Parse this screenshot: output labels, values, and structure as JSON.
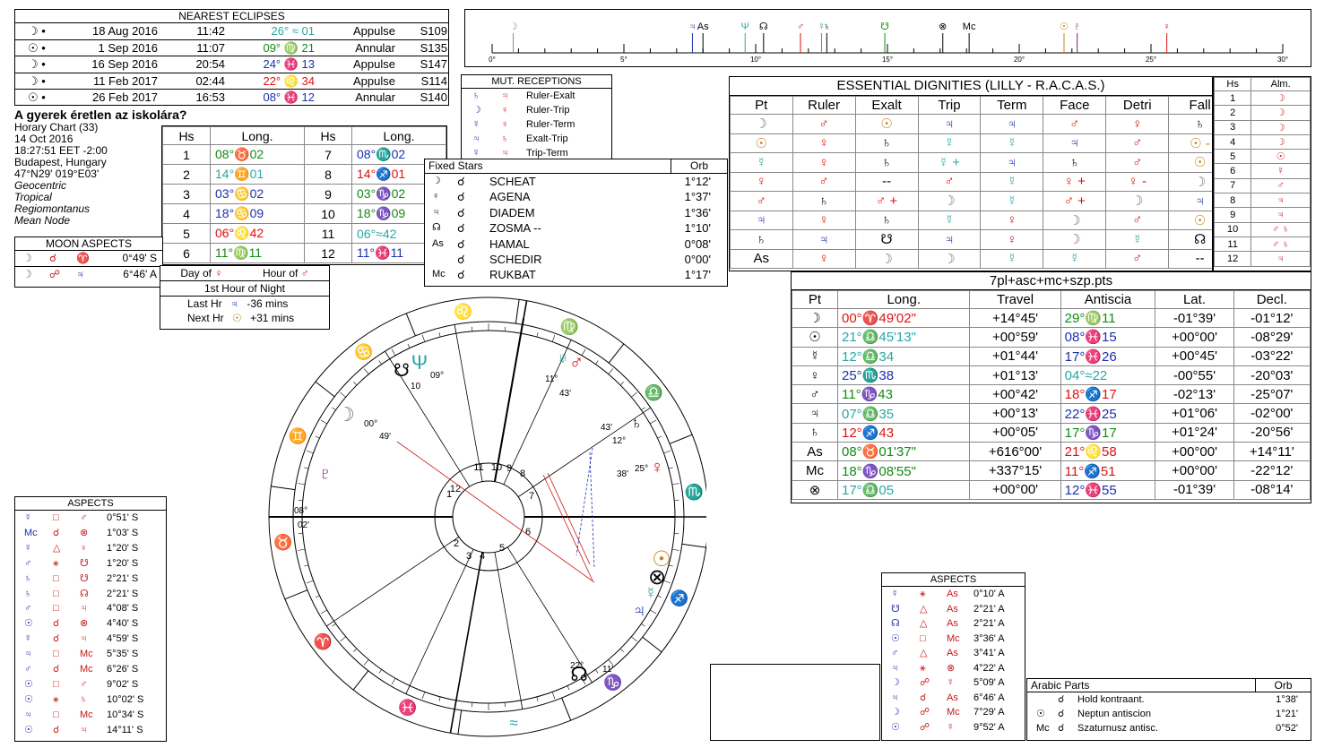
{
  "eclipses": {
    "title": "NEAREST ECLIPSES",
    "rows": [
      {
        "sym": "☽ •",
        "date": "18 Aug 2016",
        "time": "11:42",
        "pos": "26° ≈ 01",
        "pos_color": "#2aa6a6",
        "type": "Appulse",
        "saros": "S109"
      },
      {
        "sym": "☉ •",
        "date": "1 Sep 2016",
        "time": "11:07",
        "pos": "09° ♍ 21",
        "pos_color": "#138a13",
        "type": "Annular",
        "saros": "S135"
      },
      {
        "sym": "☽ •",
        "date": "16 Sep 2016",
        "time": "20:54",
        "pos": "24° ♓ 13",
        "pos_color": "#1c2fb0",
        "type": "Appulse",
        "saros": "S147"
      },
      {
        "sym": "☽ •",
        "date": "11 Feb 2017",
        "time": "02:44",
        "pos": "22° ♌ 34",
        "pos_color": "#e01010",
        "type": "Appulse",
        "saros": "S114"
      },
      {
        "sym": "☉ •",
        "date": "26 Feb 2017",
        "time": "16:53",
        "pos": "08° ♓ 12",
        "pos_color": "#1c2fb0",
        "type": "Annular",
        "saros": "S140"
      }
    ]
  },
  "chart_info": {
    "title": "A gyerek éretlen az iskolára?",
    "lines": [
      "Horary Chart (33)",
      "14 Oct 2016",
      "18:27:51  EET -2:00",
      "Budapest, Hungary",
      "47°N29' 019°E03'"
    ],
    "italic_lines": [
      "Geocentric",
      "Tropical",
      "Regiomontanus",
      "Mean Node"
    ]
  },
  "houses": {
    "headers": [
      "Hs",
      "Long.",
      "Hs",
      "Long."
    ],
    "rows": [
      {
        "h1": "1",
        "l1": "08°♉02",
        "c1": "#138a13",
        "h2": "7",
        "l2": "08°♏02",
        "c2": "#1c2fb0"
      },
      {
        "h1": "2",
        "l1": "14°♊01",
        "c1": "#2aa6a6",
        "h2": "8",
        "l2": "14°♐01",
        "c2": "#e01010"
      },
      {
        "h1": "3",
        "l1": "03°♋02",
        "c1": "#1c2fb0",
        "h2": "9",
        "l2": "03°♑02",
        "c2": "#138a13"
      },
      {
        "h1": "4",
        "l1": "18°♋09",
        "c1": "#1c2fb0",
        "h2": "10",
        "l2": "18°♑09",
        "c2": "#138a13"
      },
      {
        "h1": "5",
        "l1": "06°♌42",
        "c1": "#e01010",
        "h2": "11",
        "l2": "06°≈42",
        "c2": "#2aa6a6"
      },
      {
        "h1": "6",
        "l1": "11°♍11",
        "c1": "#138a13",
        "h2": "12",
        "l2": "11°♓11",
        "c2": "#1c2fb0"
      }
    ]
  },
  "moon_aspects": {
    "title": "MOON ASPECTS",
    "rows": [
      {
        "a": "☽",
        "b": "☌",
        "c": "♈",
        "orb": "0°49' S"
      },
      {
        "a": "☽",
        "b": "☍",
        "c": "♃",
        "orb": "6°46' A"
      }
    ]
  },
  "day_hour": {
    "day_label": "Day of",
    "day_planet": "♀",
    "hour_label": "Hour of",
    "hour_planet": "♂",
    "night": "1st Hour of Night",
    "last_label": "Last Hr",
    "last_planet": "♃",
    "last_val": "-36 mins",
    "next_label": "Next Hr",
    "next_planet": "☉",
    "next_val": "+31 mins"
  },
  "mut_receptions": {
    "title": "MUT. RECEPTIONS",
    "rows": [
      {
        "a": "♄",
        "b": "♃",
        "t": "Ruler-Exalt"
      },
      {
        "a": "☽",
        "b": "♀",
        "t": "Ruler-Trip"
      },
      {
        "a": "☿",
        "b": "♀",
        "t": "Ruler-Term"
      },
      {
        "a": "♃",
        "b": "♄",
        "t": "Exalt-Trip"
      },
      {
        "a": "☿",
        "b": "♃",
        "t": "Trip-Term"
      }
    ]
  },
  "fixed_stars": {
    "title": "Fixed Stars",
    "orb_label": "Orb",
    "rows": [
      {
        "p": "☽",
        "a": "☌",
        "n": "SCHEAT",
        "o": "1°12'"
      },
      {
        "p": "♀",
        "a": "☌",
        "n": "AGENA",
        "o": "1°37'"
      },
      {
        "p": "♃",
        "a": "☌",
        "n": "DIADEM",
        "o": "1°36'"
      },
      {
        "p": "☊",
        "a": "☌",
        "n": "ZOSMA --",
        "o": "1°10'"
      },
      {
        "p": "As",
        "a": "☌",
        "n": "HAMAL",
        "o": "0°08'"
      },
      {
        "p": "",
        "a": "☌",
        "n": "SCHEDIR",
        "o": "0°00'"
      },
      {
        "p": "Mc",
        "a": "☌",
        "n": "RUKBAT",
        "o": "1°17'"
      }
    ]
  },
  "strip": {
    "ticks": [
      "0°",
      "5°",
      "10°",
      "15°",
      "20°",
      "25°",
      "30°"
    ]
  },
  "dignities": {
    "title": "ESSENTIAL DIGNITIES (LILLY - R.A.C.A.S.)",
    "headers": [
      "Pt",
      "Ruler",
      "Exalt",
      "Trip",
      "Term",
      "Face",
      "Detri",
      "Fall"
    ],
    "rows": [
      [
        "☽",
        "♂",
        "☉",
        "♃",
        "♃",
        "♂",
        "♀",
        "♄"
      ],
      [
        "☉",
        "♀",
        "♄",
        "☿",
        "☿",
        "♃",
        "♂",
        "☉ -"
      ],
      [
        "☿",
        "♀",
        "♄",
        "☿ +",
        "♃",
        "♄",
        "♂",
        "☉"
      ],
      [
        "♀",
        "♂",
        "--",
        "♂",
        "☿",
        "♀ +",
        "♀ -",
        "☽"
      ],
      [
        "♂",
        "♄",
        "♂ +",
        "☽",
        "☿",
        "♂ +",
        "☽",
        "♃"
      ],
      [
        "♃",
        "♀",
        "♄",
        "☿",
        "♀",
        "☽",
        "♂",
        "☉"
      ],
      [
        "♄",
        "♃",
        "☋",
        "♃",
        "♀",
        "☽",
        "☿",
        "☊"
      ],
      [
        "As",
        "♀",
        "☽",
        "☽",
        "☿",
        "☿",
        "♂",
        "--"
      ]
    ]
  },
  "almuten": {
    "headers": [
      "Hs",
      "Alm."
    ],
    "rows": [
      [
        "1",
        "☽"
      ],
      [
        "2",
        "☽"
      ],
      [
        "3",
        "☽"
      ],
      [
        "4",
        "☽"
      ],
      [
        "5",
        "☉"
      ],
      [
        "6",
        "☿"
      ],
      [
        "7",
        "♂"
      ],
      [
        "8",
        "♃"
      ],
      [
        "9",
        "♃"
      ],
      [
        "10",
        "♂ ♄"
      ],
      [
        "11",
        "♂ ♄"
      ],
      [
        "12",
        "♃"
      ]
    ]
  },
  "positions": {
    "title": "7pl+asc+mc+szp.pts",
    "headers": [
      "Pt",
      "Long.",
      "Travel",
      "Antiscia",
      "Lat.",
      "Decl."
    ],
    "rows": [
      {
        "pt": "☽",
        "long": "00°♈49'02\"",
        "lc": "#e01010",
        "travel": "+14°45'",
        "anti": "29°♍11",
        "ac": "#138a13",
        "lat": "-01°39'",
        "decl": "-01°12'"
      },
      {
        "pt": "☉",
        "long": "21°♎45'13\"",
        "lc": "#2aa6a6",
        "travel": "+00°59'",
        "anti": "08°♓15",
        "ac": "#1c2fb0",
        "lat": "+00°00'",
        "decl": "-08°29'"
      },
      {
        "pt": "☿",
        "long": "12°♎34",
        "lc": "#2aa6a6",
        "travel": "+01°44'",
        "anti": "17°♓26",
        "ac": "#1c2fb0",
        "lat": "+00°45'",
        "decl": "-03°22'"
      },
      {
        "pt": "♀",
        "long": "25°♏38",
        "lc": "#1c2fb0",
        "travel": "+01°13'",
        "anti": "04°≈22",
        "ac": "#2aa6a6",
        "lat": "-00°55'",
        "decl": "-20°03'"
      },
      {
        "pt": "♂",
        "long": "11°♑43",
        "lc": "#138a13",
        "travel": "+00°42'",
        "anti": "18°♐17",
        "ac": "#e01010",
        "lat": "-02°13'",
        "decl": "-25°07'"
      },
      {
        "pt": "♃",
        "long": "07°♎35",
        "lc": "#2aa6a6",
        "travel": "+00°13'",
        "anti": "22°♓25",
        "ac": "#1c2fb0",
        "lat": "+01°06'",
        "decl": "-02°00'"
      },
      {
        "pt": "♄",
        "long": "12°♐43",
        "lc": "#e01010",
        "travel": "+00°05'",
        "anti": "17°♑17",
        "ac": "#138a13",
        "lat": "+01°24'",
        "decl": "-20°56'"
      },
      {
        "pt": "As",
        "long": "08°♉01'37\"",
        "lc": "#138a13",
        "travel": "+616°00'",
        "anti": "21°♌58",
        "ac": "#e01010",
        "lat": "+00°00'",
        "decl": "+14°11'"
      },
      {
        "pt": "Mc",
        "long": "18°♑08'55\"",
        "lc": "#138a13",
        "travel": "+337°15'",
        "anti": "11°♐51",
        "ac": "#e01010",
        "lat": "+00°00'",
        "decl": "-22°12'"
      },
      {
        "pt": "⊗",
        "long": "17°♎05",
        "lc": "#2aa6a6",
        "travel": "+00°00'",
        "anti": "12°♓55",
        "ac": "#1c2fb0",
        "lat": "-01°39'",
        "decl": "-08°14'"
      }
    ]
  },
  "aspects_left": {
    "title": "ASPECTS",
    "rows": [
      {
        "a": "☿",
        "x": "□",
        "b": "♂",
        "o": "0°51' S"
      },
      {
        "a": "Mc",
        "x": "☌",
        "b": "⊗",
        "o": "1°03' S"
      },
      {
        "a": "☿",
        "x": "△",
        "b": "♀",
        "o": "1°20' S"
      },
      {
        "a": "♂",
        "x": "⚹",
        "b": "☋",
        "o": "1°20' S"
      },
      {
        "a": "♄",
        "x": "□",
        "b": "☋",
        "o": "2°21' S"
      },
      {
        "a": "♄",
        "x": "□",
        "b": "☊",
        "o": "2°21' S"
      },
      {
        "a": "♂",
        "x": "□",
        "b": "♃",
        "o": "4°08' S"
      },
      {
        "a": "☉",
        "x": "☌",
        "b": "⊗",
        "o": "4°40' S"
      },
      {
        "a": "☿",
        "x": "☌",
        "b": "♃",
        "o": "4°59' S"
      },
      {
        "a": "♃",
        "x": "□",
        "b": "Mc",
        "o": "5°35' S"
      },
      {
        "a": "♂",
        "x": "☌",
        "b": "Mc",
        "o": "6°26' S"
      },
      {
        "a": "☉",
        "x": "□",
        "b": "♂",
        "o": "9°02' S"
      },
      {
        "a": "☉",
        "x": "⚹",
        "b": "♄",
        "o": "10°02' S"
      },
      {
        "a": "♃",
        "x": "□",
        "b": "Mc",
        "o": "10°34' S"
      },
      {
        "a": "☉",
        "x": "☌",
        "b": "♃",
        "o": "14°11' S"
      }
    ]
  },
  "aspects_right": {
    "title": "ASPECTS",
    "rows": [
      {
        "a": "☿",
        "x": "⚹",
        "b": "As",
        "o": "0°10' A"
      },
      {
        "a": "☋",
        "x": "△",
        "b": "As",
        "o": "2°21' A"
      },
      {
        "a": "☊",
        "x": "△",
        "b": "As",
        "o": "2°21' A"
      },
      {
        "a": "☉",
        "x": "□",
        "b": "Mc",
        "o": "3°36' A"
      },
      {
        "a": "♂",
        "x": "△",
        "b": "As",
        "o": "3°41' A"
      },
      {
        "a": "♃",
        "x": "⚹",
        "b": "⊗",
        "o": "4°22' A"
      },
      {
        "a": "☽",
        "x": "☍",
        "b": "☿",
        "o": "5°09' A"
      },
      {
        "a": "♃",
        "x": "☌",
        "b": "As",
        "o": "6°46' A"
      },
      {
        "a": "☽",
        "x": "☍",
        "b": "Mc",
        "o": "7°29' A"
      },
      {
        "a": "☉",
        "x": "☍",
        "b": "☿",
        "o": "9°52' A"
      }
    ]
  },
  "arabic_parts": {
    "title": "Arabic Parts",
    "orb_label": "Orb",
    "rows": [
      {
        "p": "",
        "a": "☌",
        "n": "Hold kontraant.",
        "o": "1°38'"
      },
      {
        "p": "☉",
        "a": "☌",
        "n": "Neptun antiscion",
        "o": "1°21'"
      },
      {
        "p": "Mc",
        "a": "☌",
        "n": "Szaturnusz antisc.",
        "o": "0°52'"
      }
    ]
  },
  "wheel": {
    "house_numbers": [
      "1",
      "2",
      "3",
      "4",
      "5",
      "6",
      "7",
      "8",
      "9",
      "10",
      "11",
      "12"
    ],
    "asc_label": "08°",
    "asc_min": "02'",
    "moon_deg": "00°",
    "moon_min": "49'",
    "mars_deg": "11°",
    "mars_min": "43'",
    "saturn_deg": "12°",
    "saturn_min": "43'",
    "venus_deg": "25°",
    "venus_min": "38'",
    "node_deg": "22°",
    "node_min": "11'",
    "neptune_deg": "09°",
    "neptune_min": "10"
  },
  "colors": {
    "fire": "#e01010",
    "earth": "#138a13",
    "air": "#2aa6a6",
    "water": "#1c2fb0",
    "aspect_red": "#c81818",
    "aspect_blue": "#1c2fb0"
  }
}
